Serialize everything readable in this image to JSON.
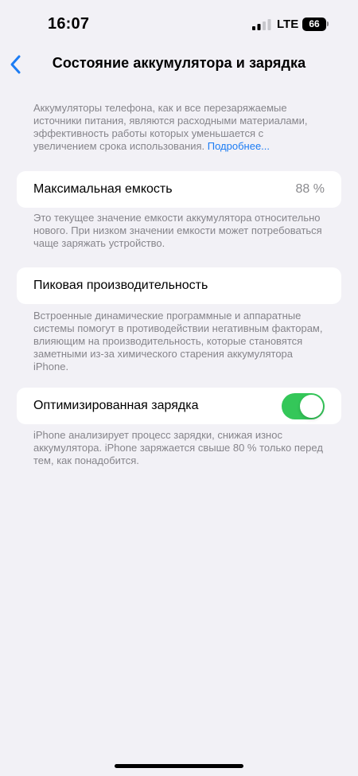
{
  "status_bar": {
    "time": "16:07",
    "network": "LTE",
    "battery_level": "66"
  },
  "nav": {
    "title": "Состояние аккумулятора и зарядка",
    "back_icon": "chevron-left-icon"
  },
  "intro": {
    "text": "Аккумуляторы телефона, как и все перезаряжаемые источники питания, являются расходными материалами, эффективность работы которых уменьшается с увеличением срока использования.",
    "link": "Подробнее..."
  },
  "max_capacity": {
    "label": "Максимальная емкость",
    "value": "88 %",
    "footnote": "Это текущее значение емкости аккумулятора относительно нового. При низком значении емкости может потребоваться чаще заряжать устройство."
  },
  "peak_performance": {
    "label": "Пиковая производительность",
    "footnote": "Встроенные динамические программные и аппаратные системы помогут в противодействии негативным факторам, влияющим на производительность, которые становятся заметными из-за химического старения аккумулятора iPhone."
  },
  "optimized_charging": {
    "label": "Оптимизированная зарядка",
    "enabled": true,
    "footnote": "iPhone анализирует процесс зарядки, снижая износ аккумулятора. iPhone заряжается свыше 80 % только перед тем, как понадобится."
  },
  "colors": {
    "background": "#f2f1f6",
    "accent": "#1c7cf4",
    "toggle_on": "#34c759",
    "secondary_text": "#86858b"
  }
}
